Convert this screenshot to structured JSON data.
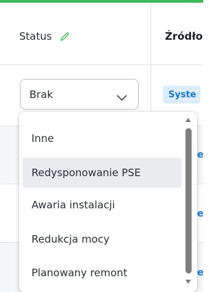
{
  "colors": {
    "top_bar": "#3dbb5a",
    "badge_bg": "#dcedfb",
    "badge_text": "#1a7ad0",
    "hover_bg": "#e9ebee"
  },
  "header": {
    "status_label": "Status",
    "status_edit_icon": "pencil-icon",
    "source_label": "Źródło"
  },
  "row": {
    "select_value": "Brak",
    "select_icon": "chevron-down-icon",
    "source_badge": "Syste"
  },
  "dropdown": {
    "hovered_index": 1,
    "options": [
      {
        "label": "Inne"
      },
      {
        "label": "Redysponowanie PSE"
      },
      {
        "label": "Awaria instalacji"
      },
      {
        "label": "Redukcja mocy"
      },
      {
        "label": "Planowany remont"
      }
    ]
  },
  "background_rows": {
    "partial_text": "e"
  }
}
